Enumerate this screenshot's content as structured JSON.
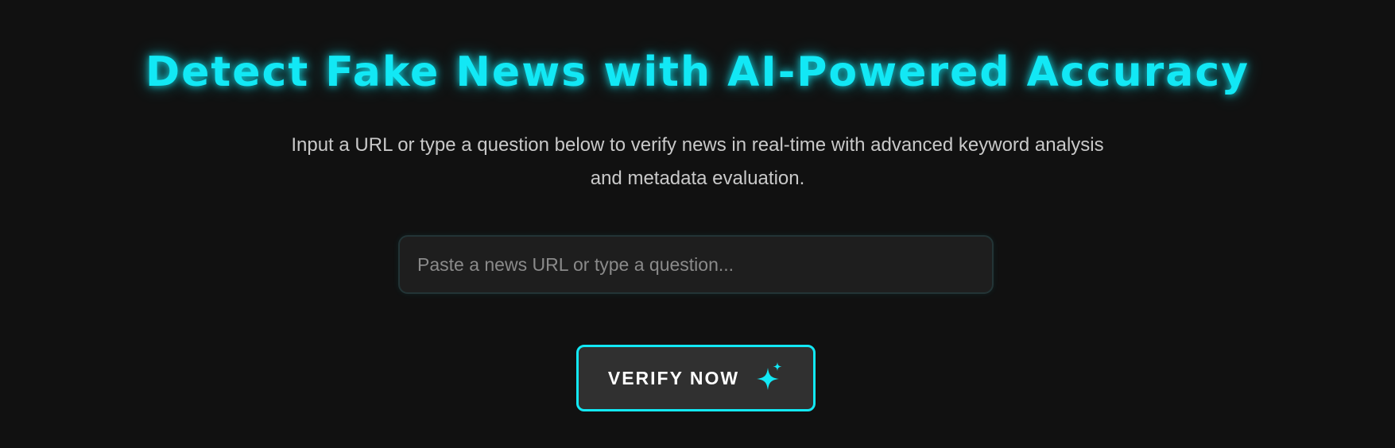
{
  "hero": {
    "title": "Detect Fake News with AI-Powered Accuracy",
    "subtitle": "Input a URL or type a question below to verify news in real-time with advanced keyword analysis and metadata evaluation."
  },
  "search": {
    "placeholder": "Paste a news URL or type a question...",
    "value": ""
  },
  "verify_button": {
    "label": "VERIFY NOW",
    "icon": "sparkle-icon"
  },
  "colors": {
    "background": "#111111",
    "accent": "#12e8f5",
    "button_fill": "#303030",
    "input_fill": "#1e1e1e"
  }
}
